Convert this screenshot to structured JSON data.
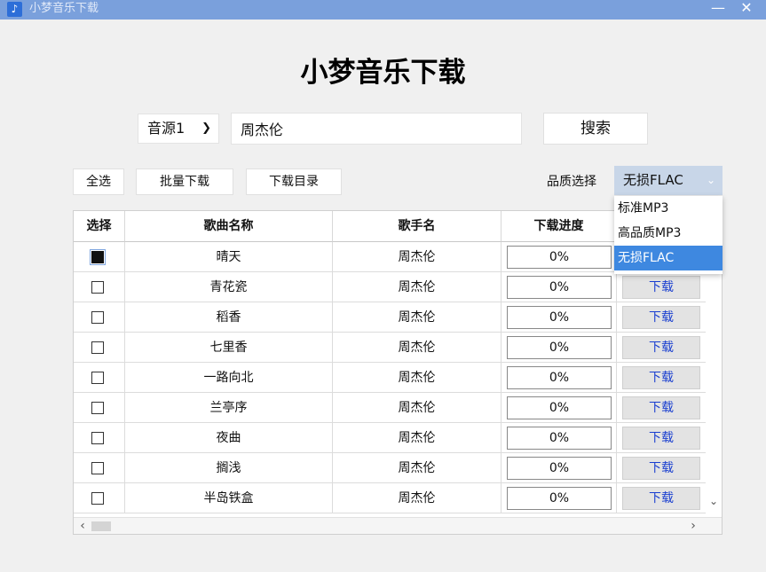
{
  "window": {
    "title": "小梦音乐下载",
    "minimize": "—",
    "close": "✕"
  },
  "heading": "小梦音乐下载",
  "search": {
    "source": "音源1",
    "query": "周杰伦",
    "button": "搜索"
  },
  "toolbar": {
    "select_all": "全选",
    "batch_download": "批量下载",
    "download_dir": "下载目录"
  },
  "quality": {
    "label": "品质选择",
    "selected": "无损FLAC",
    "options": [
      "标准MP3",
      "高品质MP3",
      "无损FLAC"
    ]
  },
  "table": {
    "headers": [
      "选择",
      "歌曲名称",
      "歌手名",
      "下载进度"
    ],
    "download_label": "下载",
    "rows": [
      {
        "title": "晴天",
        "artist": "周杰伦",
        "progress": "0%",
        "checked": true
      },
      {
        "title": "青花瓷",
        "artist": "周杰伦",
        "progress": "0%",
        "checked": false
      },
      {
        "title": "稻香",
        "artist": "周杰伦",
        "progress": "0%",
        "checked": false
      },
      {
        "title": "七里香",
        "artist": "周杰伦",
        "progress": "0%",
        "checked": false
      },
      {
        "title": "一路向北",
        "artist": "周杰伦",
        "progress": "0%",
        "checked": false
      },
      {
        "title": "兰亭序",
        "artist": "周杰伦",
        "progress": "0%",
        "checked": false
      },
      {
        "title": "夜曲",
        "artist": "周杰伦",
        "progress": "0%",
        "checked": false
      },
      {
        "title": "搁浅",
        "artist": "周杰伦",
        "progress": "0%",
        "checked": false
      },
      {
        "title": "半岛铁盒",
        "artist": "周杰伦",
        "progress": "0%",
        "checked": false
      }
    ]
  },
  "colors": {
    "titlebar": "#7aa0dc",
    "accent": "#3e88e0",
    "download_text": "#1a3fd0"
  }
}
